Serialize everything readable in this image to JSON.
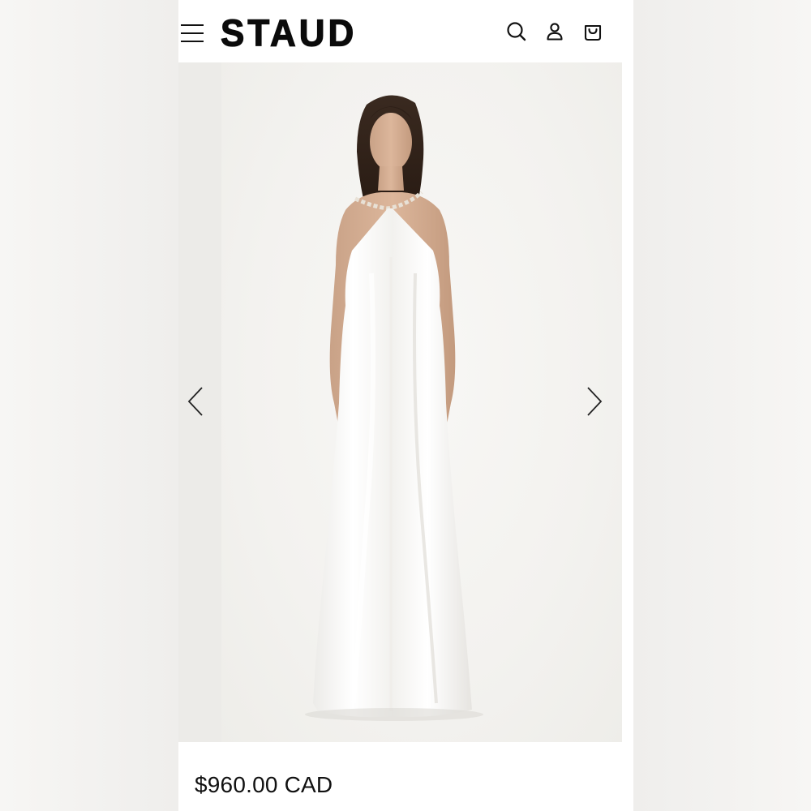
{
  "header": {
    "brand": "STAUD",
    "menu_icon": "hamburger-menu-icon",
    "search_icon": "search-icon",
    "account_icon": "user-icon",
    "bag_icon": "shopping-bag-icon"
  },
  "gallery": {
    "image_alt": "Model wearing white satin halter maxi dress",
    "prev_icon": "chevron-left-icon",
    "next_icon": "chevron-right-icon"
  },
  "product": {
    "price": "$960.00 CAD"
  },
  "colors": {
    "text": "#111111",
    "background": "#ffffff",
    "gallery_bg": "#f3f2ef"
  }
}
